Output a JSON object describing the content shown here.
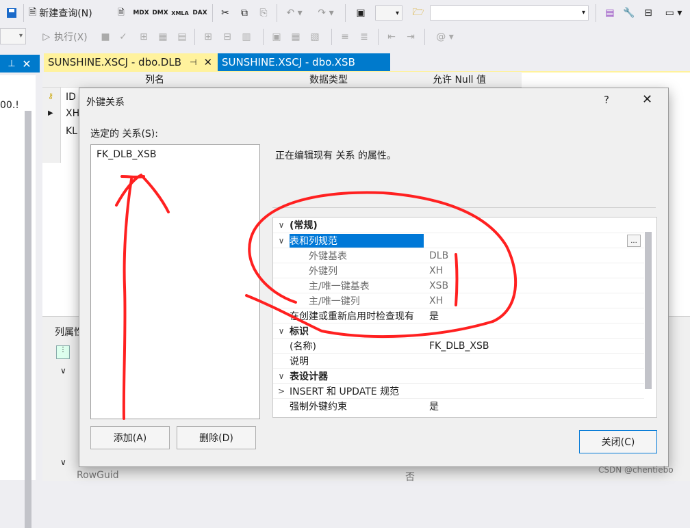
{
  "toolbar1": {
    "new_query_label": "新建查询(N)"
  },
  "toolbar2": {
    "execute_label": "执行(X)"
  },
  "panel_left": {
    "pin_icon": "pin-icon",
    "close_icon": "close-icon",
    "partial_text": "00.!"
  },
  "tabs": [
    {
      "label": "SUNSHINE.XSCJ - dbo.DLB",
      "active": true
    },
    {
      "label": "SUNSHINE.XSCJ - dbo.XSB",
      "active": false
    }
  ],
  "grid": {
    "headers": [
      "列名",
      "数据类型",
      "允许 Null 值"
    ],
    "rows": [
      "ID",
      "XH",
      "KL"
    ]
  },
  "column_props": {
    "title": "列属性",
    "row_guid": "RowGuid",
    "row_guid_value": "否"
  },
  "dialog": {
    "title": "外键关系",
    "help": "?",
    "selected_label": "选定的 关系(S):",
    "relations": [
      "FK_DLB_XSB"
    ],
    "description": "正在编辑现有 关系 的属性。",
    "add_button": "添加(A)",
    "delete_button": "删除(D)",
    "close_button": "关闭(C)",
    "ellipsis": "...",
    "properties": [
      {
        "name": "(常规)",
        "value": "",
        "bold": true,
        "expander": "∨",
        "indent": 0
      },
      {
        "name": "表和列规范",
        "value": "",
        "bold": false,
        "expander": "∨",
        "indent": 0,
        "selected": true
      },
      {
        "name": "外键基表",
        "value": "DLB",
        "muted": true,
        "indent": 1
      },
      {
        "name": "外键列",
        "value": "XH",
        "muted": true,
        "indent": 1
      },
      {
        "name": "主/唯一键基表",
        "value": "XSB",
        "muted": true,
        "indent": 1
      },
      {
        "name": "主/唯一键列",
        "value": "XH",
        "muted": true,
        "indent": 1
      },
      {
        "name": "在创建或重新启用时检查现有",
        "value": "是",
        "indent": 0
      },
      {
        "name": "标识",
        "value": "",
        "bold": true,
        "expander": "∨",
        "indent": 0
      },
      {
        "name": "(名称)",
        "value": "FK_DLB_XSB",
        "indent": 0
      },
      {
        "name": "说明",
        "value": "",
        "indent": 0
      },
      {
        "name": "表设计器",
        "value": "",
        "bold": true,
        "expander": "∨",
        "indent": 0
      },
      {
        "name": "INSERT 和 UPDATE 规范",
        "value": "",
        "expander": ">",
        "indent": 0
      },
      {
        "name": "强制外键约束",
        "value": "是",
        "indent": 0
      }
    ]
  },
  "watermark": "CSDN @chentiebo",
  "colors": {
    "accent": "#007acc",
    "annotation_red": "#ff2020",
    "tab_active_bg": "#fff29d"
  }
}
